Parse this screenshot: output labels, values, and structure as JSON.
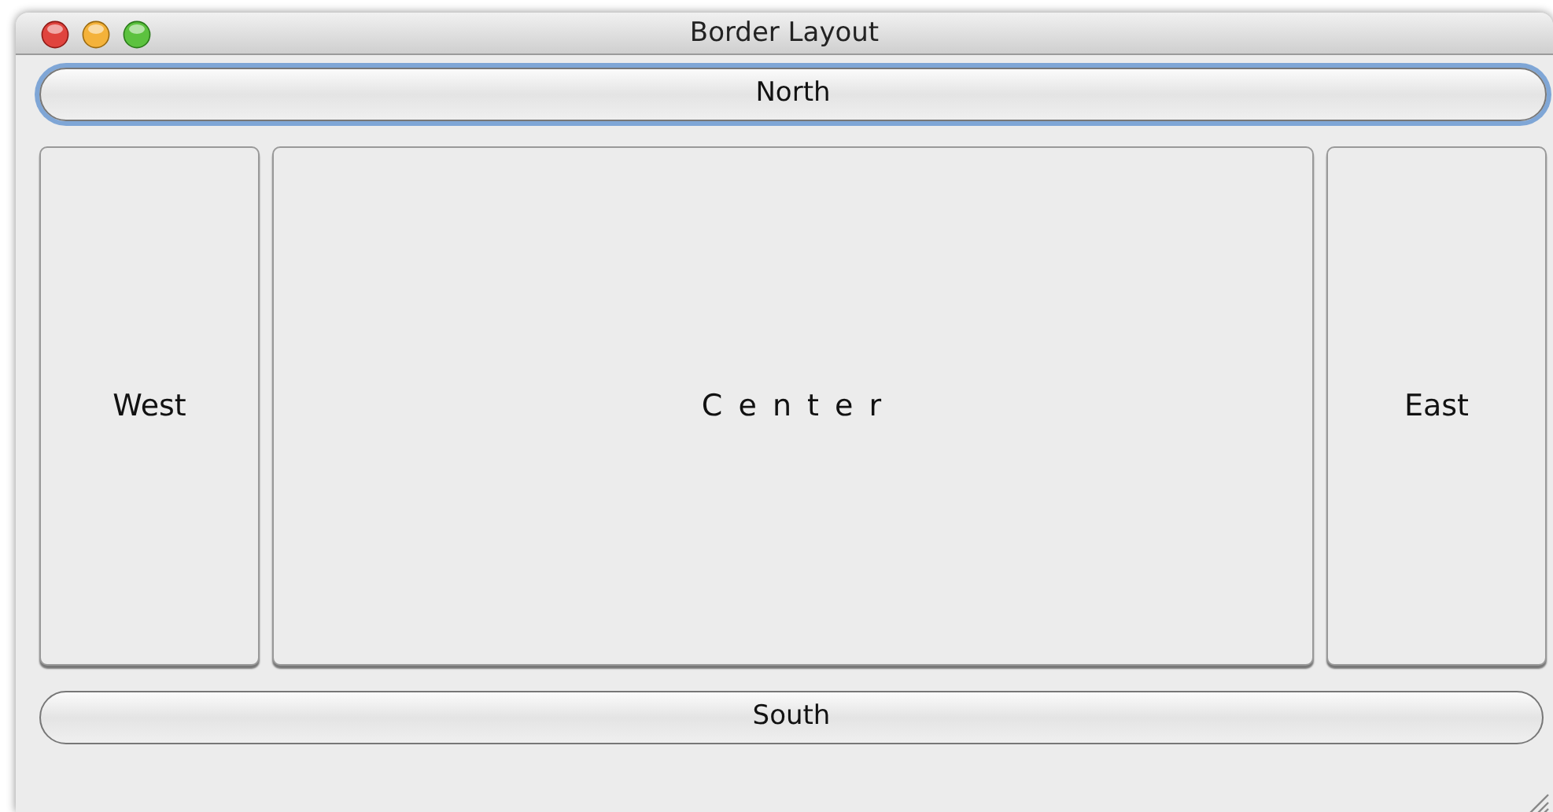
{
  "window": {
    "title": "Border Layout"
  },
  "buttons": [
    {
      "kind": "north",
      "label": "North",
      "focused": true
    },
    {
      "kind": "west",
      "label": "West",
      "focused": false
    },
    {
      "kind": "center",
      "label": "C e n t e r",
      "focused": false
    },
    {
      "kind": "east",
      "label": "East",
      "focused": false
    },
    {
      "kind": "south",
      "label": "South",
      "focused": false
    }
  ]
}
